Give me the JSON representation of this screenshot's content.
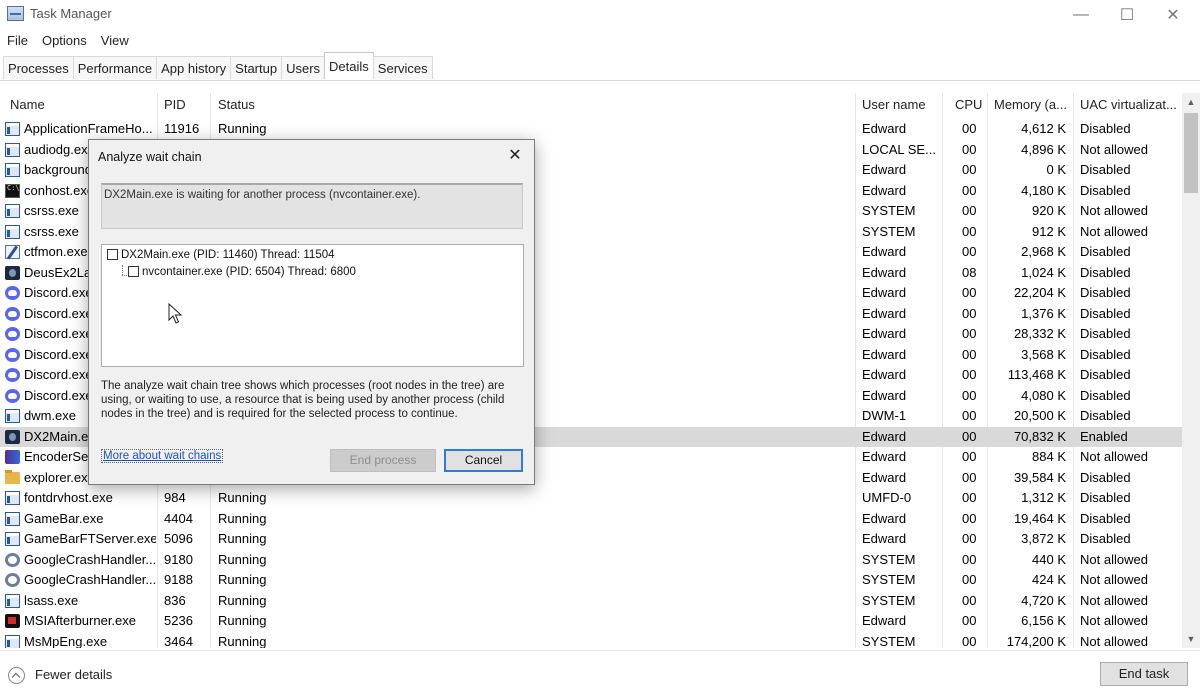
{
  "window": {
    "title": "Task Manager",
    "minimize_glyph": "—",
    "maximize_glyph": "☐",
    "close_glyph": "✕",
    "app_icon": "task-manager-icon"
  },
  "menu": [
    "File",
    "Options",
    "View"
  ],
  "tabs": [
    {
      "label": "Processes",
      "active": false
    },
    {
      "label": "Performance",
      "active": false
    },
    {
      "label": "App history",
      "active": false
    },
    {
      "label": "Startup",
      "active": false
    },
    {
      "label": "Users",
      "active": false
    },
    {
      "label": "Details",
      "active": true
    },
    {
      "label": "Services",
      "active": false
    }
  ],
  "columns": {
    "name": "Name",
    "pid": "PID",
    "status": "Status",
    "user": "User name",
    "cpu": "CPU",
    "memory": "Memory (a...",
    "uac": "UAC virtualizat..."
  },
  "sort_arrow": "^",
  "rows": [
    {
      "icon": "window",
      "name": "ApplicationFrameHo...",
      "pid": "11916",
      "status": "Running",
      "user": "Edward",
      "cpu": "00",
      "memory": "4,612 K",
      "uac": "Disabled"
    },
    {
      "icon": "window",
      "name": "audiodg.exe",
      "pid": "",
      "status": "",
      "user": "LOCAL SE...",
      "cpu": "00",
      "memory": "4,896 K",
      "uac": "Not allowed"
    },
    {
      "icon": "window",
      "name": "background",
      "pid": "",
      "status": "",
      "user": "Edward",
      "cpu": "00",
      "memory": "0 K",
      "uac": "Disabled"
    },
    {
      "icon": "console",
      "name": "conhost.exe",
      "pid": "",
      "status": "",
      "user": "Edward",
      "cpu": "00",
      "memory": "4,180 K",
      "uac": "Disabled"
    },
    {
      "icon": "window",
      "name": "csrss.exe",
      "pid": "",
      "status": "",
      "user": "SYSTEM",
      "cpu": "00",
      "memory": "920 K",
      "uac": "Not allowed"
    },
    {
      "icon": "window",
      "name": "csrss.exe",
      "pid": "",
      "status": "",
      "user": "SYSTEM",
      "cpu": "00",
      "memory": "912 K",
      "uac": "Not allowed"
    },
    {
      "icon": "pen",
      "name": "ctfmon.exe",
      "pid": "",
      "status": "",
      "user": "Edward",
      "cpu": "00",
      "memory": "2,968 K",
      "uac": "Disabled"
    },
    {
      "icon": "deus",
      "name": "DeusEx2Lau",
      "pid": "",
      "status": "",
      "user": "Edward",
      "cpu": "08",
      "memory": "1,024 K",
      "uac": "Disabled"
    },
    {
      "icon": "discord",
      "name": "Discord.exe",
      "pid": "",
      "status": "",
      "user": "Edward",
      "cpu": "00",
      "memory": "22,204 K",
      "uac": "Disabled"
    },
    {
      "icon": "discord",
      "name": "Discord.exe",
      "pid": "",
      "status": "",
      "user": "Edward",
      "cpu": "00",
      "memory": "1,376 K",
      "uac": "Disabled"
    },
    {
      "icon": "discord",
      "name": "Discord.exe",
      "pid": "",
      "status": "",
      "user": "Edward",
      "cpu": "00",
      "memory": "28,332 K",
      "uac": "Disabled"
    },
    {
      "icon": "discord",
      "name": "Discord.exe",
      "pid": "",
      "status": "",
      "user": "Edward",
      "cpu": "00",
      "memory": "3,568 K",
      "uac": "Disabled"
    },
    {
      "icon": "discord",
      "name": "Discord.exe",
      "pid": "",
      "status": "",
      "user": "Edward",
      "cpu": "00",
      "memory": "113,468 K",
      "uac": "Disabled"
    },
    {
      "icon": "discord",
      "name": "Discord.exe",
      "pid": "",
      "status": "",
      "user": "Edward",
      "cpu": "00",
      "memory": "4,080 K",
      "uac": "Disabled"
    },
    {
      "icon": "window",
      "name": "dwm.exe",
      "pid": "",
      "status": "",
      "user": "DWM-1",
      "cpu": "00",
      "memory": "20,500 K",
      "uac": "Disabled"
    },
    {
      "icon": "deus",
      "name": "DX2Main.exe",
      "pid": "",
      "status": "",
      "user": "Edward",
      "cpu": "00",
      "memory": "70,832 K",
      "uac": "Enabled",
      "selected": true
    },
    {
      "icon": "encoder",
      "name": "EncoderServer",
      "pid": "",
      "status": "",
      "user": "Edward",
      "cpu": "00",
      "memory": "884 K",
      "uac": "Not allowed"
    },
    {
      "icon": "folder",
      "name": "explorer.exe",
      "pid": "",
      "status": "",
      "user": "Edward",
      "cpu": "00",
      "memory": "39,584 K",
      "uac": "Disabled"
    },
    {
      "icon": "window",
      "name": "fontdrvhost.exe",
      "pid": "984",
      "status": "Running",
      "user": "UMFD-0",
      "cpu": "00",
      "memory": "1,312 K",
      "uac": "Disabled"
    },
    {
      "icon": "window",
      "name": "GameBar.exe",
      "pid": "4404",
      "status": "Running",
      "user": "Edward",
      "cpu": "00",
      "memory": "19,464 K",
      "uac": "Disabled"
    },
    {
      "icon": "window",
      "name": "GameBarFTServer.exe",
      "pid": "5096",
      "status": "Running",
      "user": "Edward",
      "cpu": "00",
      "memory": "3,872 K",
      "uac": "Disabled"
    },
    {
      "icon": "gear",
      "name": "GoogleCrashHandler...",
      "pid": "9180",
      "status": "Running",
      "user": "SYSTEM",
      "cpu": "00",
      "memory": "440 K",
      "uac": "Not allowed"
    },
    {
      "icon": "gear",
      "name": "GoogleCrashHandler...",
      "pid": "9188",
      "status": "Running",
      "user": "SYSTEM",
      "cpu": "00",
      "memory": "424 K",
      "uac": "Not allowed"
    },
    {
      "icon": "window",
      "name": "lsass.exe",
      "pid": "836",
      "status": "Running",
      "user": "SYSTEM",
      "cpu": "00",
      "memory": "4,720 K",
      "uac": "Not allowed"
    },
    {
      "icon": "afterburner",
      "name": "MSIAfterburner.exe",
      "pid": "5236",
      "status": "Running",
      "user": "Edward",
      "cpu": "00",
      "memory": "6,156 K",
      "uac": "Not allowed"
    },
    {
      "icon": "window",
      "name": "MsMpEng.exe",
      "pid": "3464",
      "status": "Running",
      "user": "SYSTEM",
      "cpu": "00",
      "memory": "174,200 K",
      "uac": "Not allowed"
    }
  ],
  "scrollbar": {
    "up_glyph": "▲",
    "down_glyph": "▼"
  },
  "footer": {
    "fewer_details": "Fewer details",
    "end_task": "End task"
  },
  "dialog": {
    "title": "Analyze wait chain",
    "close_glyph": "✕",
    "message": "DX2Main.exe is waiting for another process (nvcontainer.exe).",
    "tree": [
      {
        "label": "DX2Main.exe (PID: 11460) Thread: 11504",
        "level": 0
      },
      {
        "label": "nvcontainer.exe (PID: 6504) Thread: 6800",
        "level": 1
      }
    ],
    "description": "The analyze wait chain tree shows which processes (root nodes in the tree) are using, or waiting to use, a resource that is being used by another process (child nodes in the tree) and is required for the selected process to continue.",
    "link": "More about wait chains",
    "end_process": "End process",
    "cancel": "Cancel"
  }
}
